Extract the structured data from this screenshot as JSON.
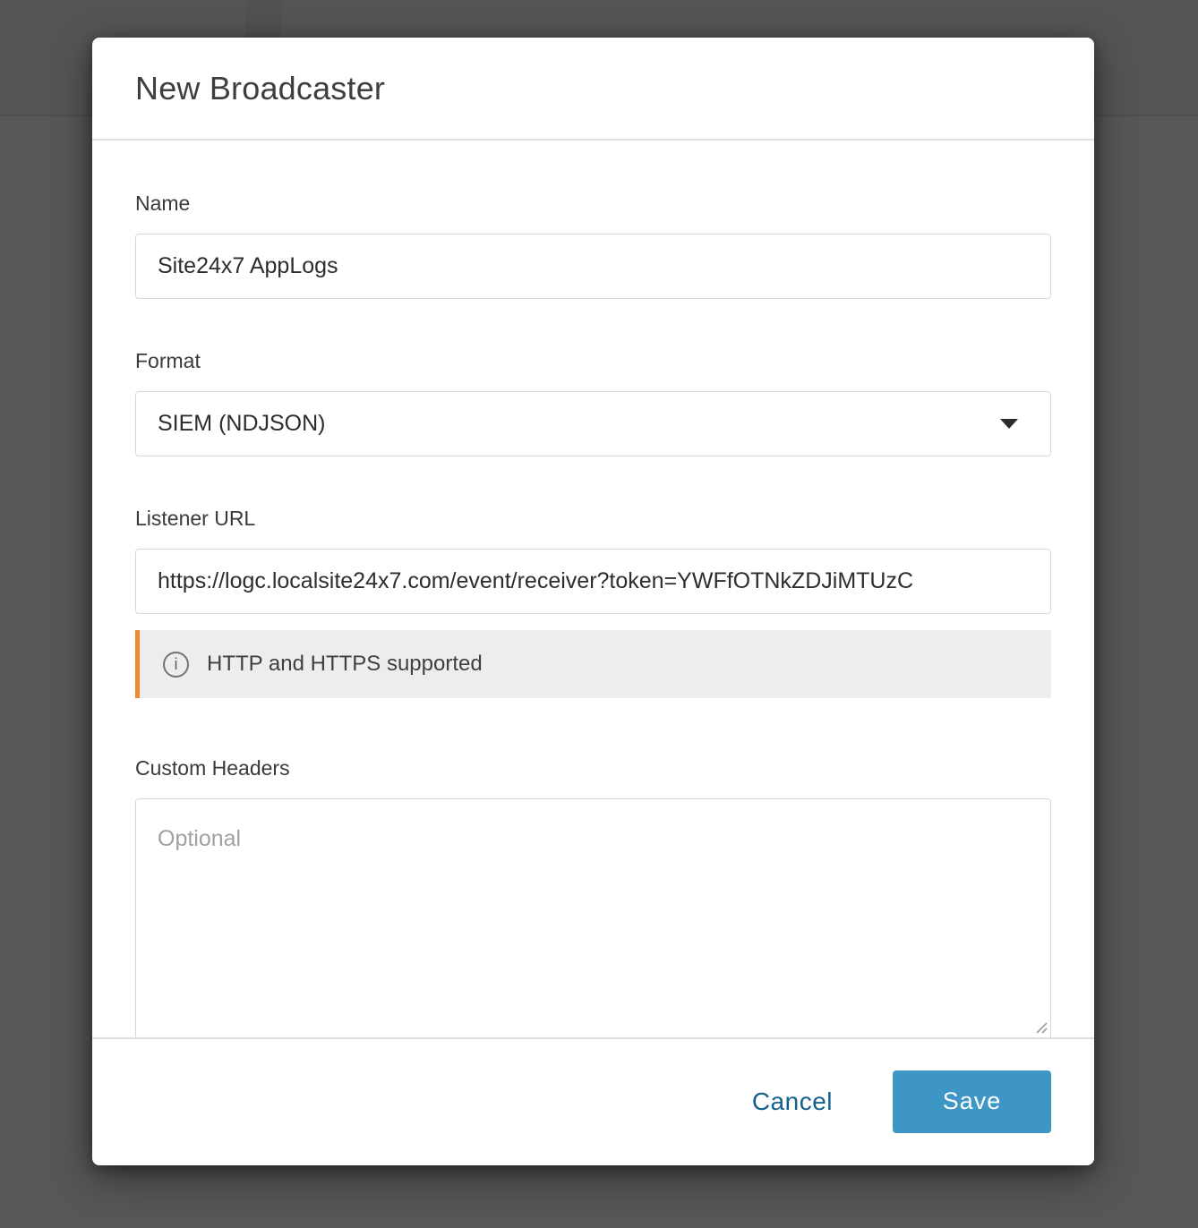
{
  "backdrop": {
    "color": "#565758"
  },
  "modal": {
    "title": "New Broadcaster",
    "form": {
      "name": {
        "label": "Name",
        "value": "Site24x7 AppLogs"
      },
      "format": {
        "label": "Format",
        "value": "SIEM (NDJSON)",
        "dropdown_icon": "chevron-down"
      },
      "listener_url": {
        "label": "Listener URL",
        "value": "https://logc.localsite24x7.com/event/receiver?token=YWFfOTNkZDJiMTUzC"
      },
      "info": {
        "icon": "i",
        "text": "HTTP and HTTPS supported",
        "accent_color": "#ee8a2b",
        "background_color": "#ededee"
      },
      "custom_headers": {
        "label": "Custom Headers",
        "placeholder": "Optional",
        "value": ""
      }
    },
    "footer": {
      "cancel_label": "Cancel",
      "cancel_color": "#15618e",
      "save_label": "Save",
      "save_color": "#3e96c5"
    }
  }
}
